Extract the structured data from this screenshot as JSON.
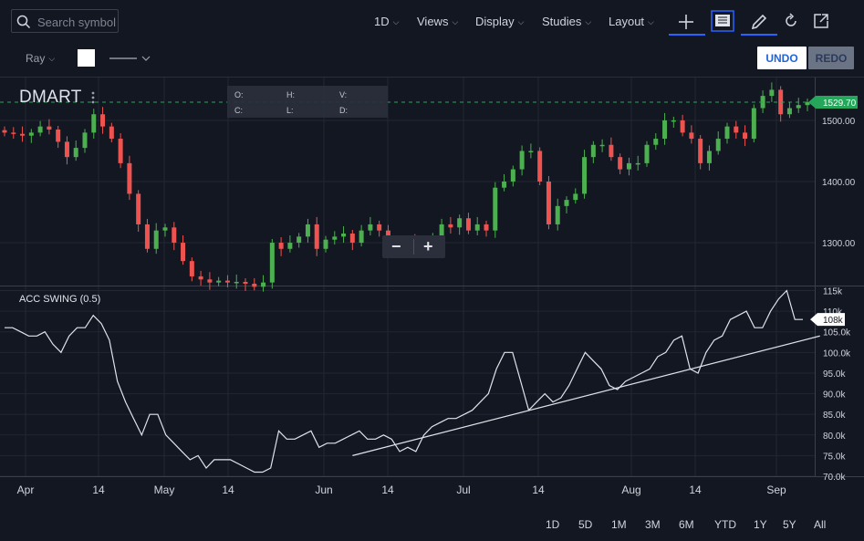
{
  "toolbar": {
    "search_placeholder": "Search symbol",
    "interval": "1D",
    "views": "Views",
    "display": "Display",
    "studies": "Studies",
    "layout": "Layout"
  },
  "drawing": {
    "tool": "Ray",
    "color": "#ffffff",
    "undo": "UNDO",
    "redo": "REDO"
  },
  "chart": {
    "symbol": "DMART",
    "ohlc_labels": {
      "o": "O:",
      "h": "H:",
      "v": "V:",
      "c": "C:",
      "l": "L:",
      "d": "D:"
    },
    "current_price": "1529.70",
    "indicator_label": "ACC SWING (0.5)",
    "indicator_current": "108k",
    "zoom_out": "−",
    "zoom_in": "+"
  },
  "range_buttons": [
    "1D",
    "5D",
    "1M",
    "3M",
    "6M",
    "YTD",
    "1Y",
    "5Y",
    "All"
  ],
  "colors": {
    "up": "#4caf50",
    "down": "#ef5350",
    "accent": "#2962ff",
    "badge": "#26a65b"
  },
  "chart_data": [
    {
      "type": "candlestick",
      "title": "DMART",
      "y_ticks": [
        "1300.00",
        "1400.00",
        "1500.00"
      ],
      "x_ticks": [
        "Apr",
        "14",
        "May",
        "14",
        "Jun",
        "14",
        "Jul",
        "14",
        "Aug",
        "14",
        "Sep"
      ],
      "ylim": [
        1230,
        1570
      ],
      "last_value": 1529.7,
      "close_approx": [
        1480,
        1478,
        1475,
        1480,
        1490,
        1485,
        1465,
        1440,
        1455,
        1480,
        1510,
        1490,
        1470,
        1430,
        1380,
        1330,
        1290,
        1320,
        1325,
        1300,
        1270,
        1245,
        1240,
        1235,
        1238,
        1235,
        1236,
        1233,
        1228,
        1235,
        1300,
        1290,
        1300,
        1310,
        1330,
        1290,
        1305,
        1310,
        1315,
        1300,
        1320,
        1330,
        1320,
        1300,
        1298,
        1305,
        1300,
        1295,
        1310,
        1330,
        1325,
        1340,
        1320,
        1330,
        1320,
        1390,
        1400,
        1420,
        1450,
        1450,
        1400,
        1330,
        1360,
        1370,
        1380,
        1440,
        1460,
        1460,
        1440,
        1420,
        1430,
        1430,
        1460,
        1470,
        1500,
        1500,
        1480,
        1470,
        1430,
        1450,
        1470,
        1490,
        1480,
        1470,
        1520,
        1540,
        1550,
        1510,
        1520,
        1525,
        1529.7
      ]
    },
    {
      "type": "line",
      "title": "ACC SWING (0.5)",
      "y_ticks": [
        "70.0k",
        "75.0k",
        "80.0k",
        "85.0k",
        "90.0k",
        "95.0k",
        "100.0k",
        "105.0k",
        "110k",
        "115k"
      ],
      "ylim": [
        70,
        116
      ],
      "last_value": 108,
      "values": [
        106,
        106,
        105,
        104,
        104,
        105,
        102,
        100,
        104,
        106,
        106,
        109,
        107,
        103,
        93,
        88,
        84,
        80,
        85,
        85,
        80,
        78,
        76,
        74,
        75,
        72,
        74,
        74,
        74,
        73,
        72,
        71,
        71,
        72,
        81,
        79,
        79,
        80,
        81,
        77,
        78,
        78,
        79,
        80,
        81,
        79,
        79,
        80,
        79,
        76,
        77,
        76,
        80,
        82,
        83,
        84,
        84,
        85,
        86,
        88,
        90,
        96,
        100,
        100,
        93,
        86,
        88,
        90,
        88,
        89,
        92,
        96,
        100,
        98,
        96,
        92,
        91,
        93,
        94,
        95,
        96,
        99,
        100,
        103,
        104,
        96,
        95,
        100,
        103,
        104,
        108,
        109,
        110,
        106,
        106,
        110,
        113,
        115,
        108,
        108
      ],
      "trendline": [
        [
          0.408,
          75
        ],
        [
          0.949,
          104
        ]
      ]
    }
  ]
}
